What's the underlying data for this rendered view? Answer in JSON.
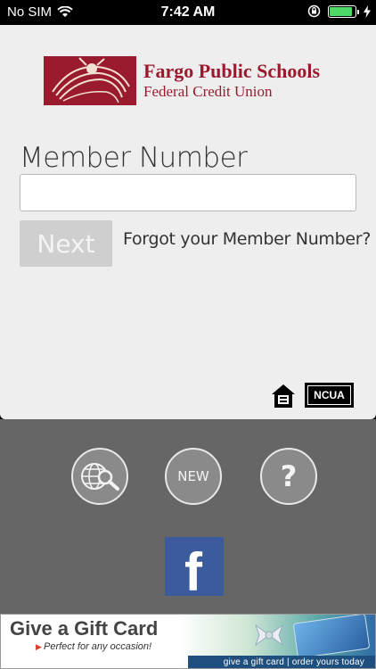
{
  "status_bar": {
    "carrier": "No SIM",
    "time": "7:42 AM",
    "battery_level": 0.9
  },
  "logo": {
    "title": "Fargo Public Schools",
    "subtitle": "Federal Credit Union",
    "color": "#9b1b2e"
  },
  "login": {
    "member_label": "Member Number",
    "member_value": "",
    "member_placeholder": "",
    "next_label": "Next",
    "forgot_label": "Forgot your Member Number?"
  },
  "badges": {
    "ncua": "NCUA"
  },
  "actions": {
    "new_label": "NEW",
    "help_label": "?",
    "facebook_label": "f"
  },
  "banner": {
    "title": "Give a Gift Card",
    "subtitle": "Perfect for any occasion!",
    "cta": "give a gift card | order yours today"
  }
}
